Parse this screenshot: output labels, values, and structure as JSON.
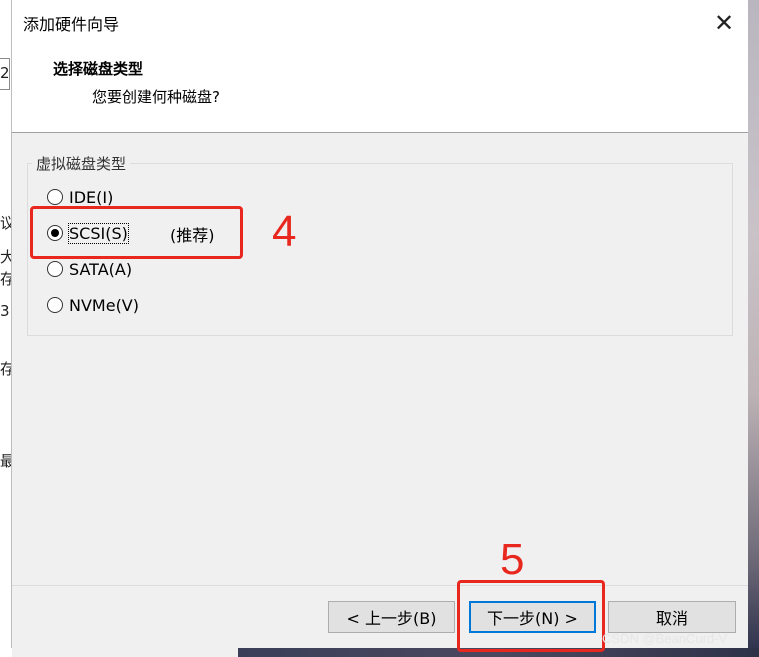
{
  "background": {
    "left_fragments": [
      "2",
      "议",
      "大",
      "存",
      "3",
      "存",
      "最"
    ]
  },
  "dialog": {
    "title": "添加硬件向导",
    "close_symbol": "✕",
    "header_title": "选择磁盘类型",
    "header_subtitle": "您要创建何种磁盘?"
  },
  "disk_type": {
    "group_label": "虚拟磁盘类型",
    "options": [
      {
        "label": "IDE(I)",
        "checked": false
      },
      {
        "label": "SCSI(S)",
        "checked": true
      },
      {
        "label": "SATA(A)",
        "checked": false
      },
      {
        "label": "NVMe(V)",
        "checked": false
      }
    ],
    "recommended_text": "(推荐)"
  },
  "buttons": {
    "back": "< 上一步(B)",
    "next": "下一步(N) >",
    "cancel": "取消"
  },
  "annotations": {
    "step4": "4",
    "step5": "5",
    "color": "#e8281e"
  },
  "watermark": "CSDN @BeanCurd-V"
}
